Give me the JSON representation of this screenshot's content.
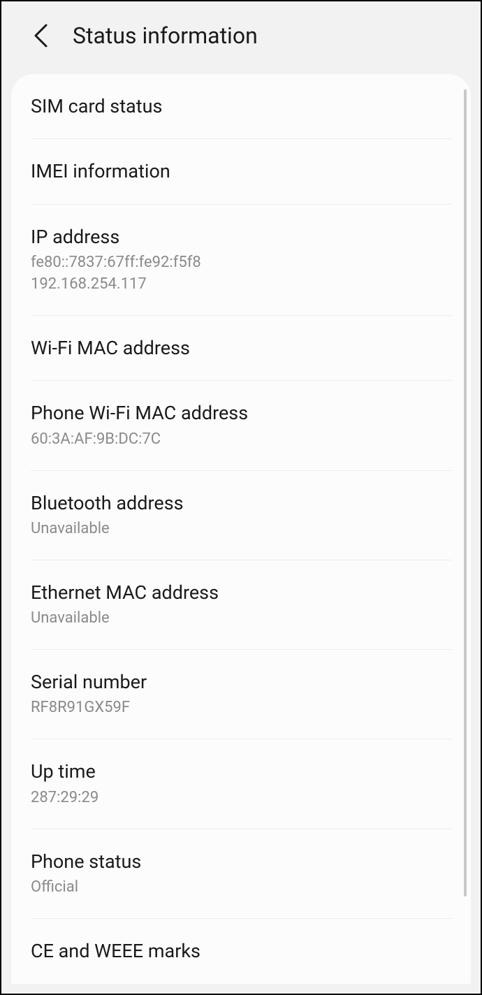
{
  "header": {
    "title": "Status information"
  },
  "items": [
    {
      "title": "SIM card status",
      "value": ""
    },
    {
      "title": "IMEI information",
      "value": ""
    },
    {
      "title": "IP address",
      "value": "fe80::7837:67ff:fe92:f5f8\n192.168.254.117"
    },
    {
      "title": "Wi-Fi MAC address",
      "value": ""
    },
    {
      "title": "Phone Wi-Fi MAC address",
      "value": "60:3A:AF:9B:DC:7C"
    },
    {
      "title": "Bluetooth address",
      "value": "Unavailable"
    },
    {
      "title": "Ethernet MAC address",
      "value": "Unavailable"
    },
    {
      "title": "Serial number",
      "value": "RF8R91GX59F"
    },
    {
      "title": "Up time",
      "value": "287:29:29"
    },
    {
      "title": "Phone status",
      "value": "Official"
    },
    {
      "title": "CE and WEEE marks",
      "value": ""
    }
  ]
}
